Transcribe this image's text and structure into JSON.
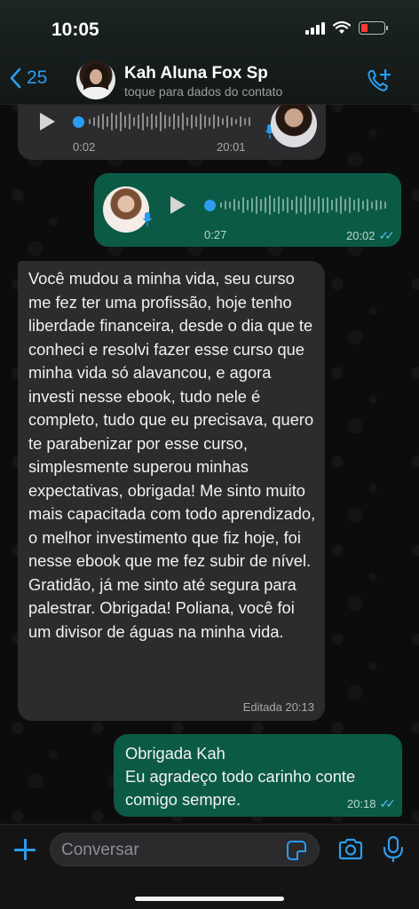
{
  "status": {
    "time": "10:05"
  },
  "header": {
    "back_count": "25",
    "contact_name": "Kah Aluna Fox Sp",
    "subtitle": "toque para dados do contato",
    "accent": "#2c9cf0"
  },
  "messages": {
    "audio_in": {
      "duration": "0:02",
      "time": "20:01"
    },
    "audio_out": {
      "duration": "0:27",
      "time": "20:02"
    },
    "text_in": {
      "text": "Você mudou a minha vida, seu curso me fez ter uma profissão, hoje tenho liberdade financeira, desde o dia que te conheci e resolvi fazer esse curso que minha vida só alavancou, e agora investi nesse ebook, tudo nele é completo, tudo que eu precisava, quero te parabenizar por esse curso, simplesmente superou minhas expectativas, obrigada! Me sinto muito mais capacitada com todo aprendizado, o melhor investimento que fiz hoje, foi nesse ebook que me fez subir de nível. Gratidão,  já me sinto até segura para palestrar. Obrigada! Poliana, você foi um divisor de águas na minha vida.",
      "meta": "Editada 20:13"
    },
    "text_out": {
      "line1": "Obrigada Kah",
      "line2": "Eu agradeço todo carinho conte comigo sempre.",
      "time": "20:18"
    },
    "outgoing_color": "#0b5a45",
    "incoming_color": "#2c2c2e"
  },
  "input": {
    "placeholder": "Conversar"
  },
  "icons": [
    "chevron-left-icon",
    "call-add-icon",
    "play-icon",
    "mic-icon",
    "plus-icon",
    "sticker-icon",
    "camera-icon",
    "read-ticks-icon"
  ]
}
